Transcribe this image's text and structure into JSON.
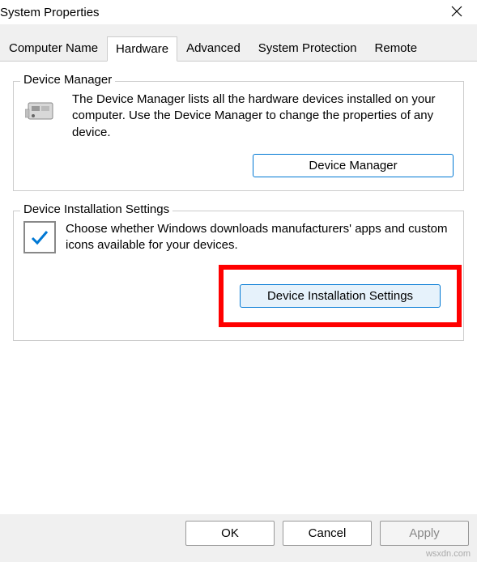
{
  "window": {
    "title": "System Properties"
  },
  "tabs": {
    "computer_name": "Computer Name",
    "hardware": "Hardware",
    "advanced": "Advanced",
    "system_protection": "System Protection",
    "remote": "Remote"
  },
  "device_manager_group": {
    "legend": "Device Manager",
    "description": "The Device Manager lists all the hardware devices installed on your computer. Use the Device Manager to change the properties of any device.",
    "button": "Device Manager"
  },
  "device_installation_group": {
    "legend": "Device Installation Settings",
    "description": "Choose whether Windows downloads manufacturers' apps and custom icons available for your devices.",
    "button": "Device Installation Settings"
  },
  "footer": {
    "ok": "OK",
    "cancel": "Cancel",
    "apply": "Apply"
  },
  "watermark": "wsxdn.com"
}
